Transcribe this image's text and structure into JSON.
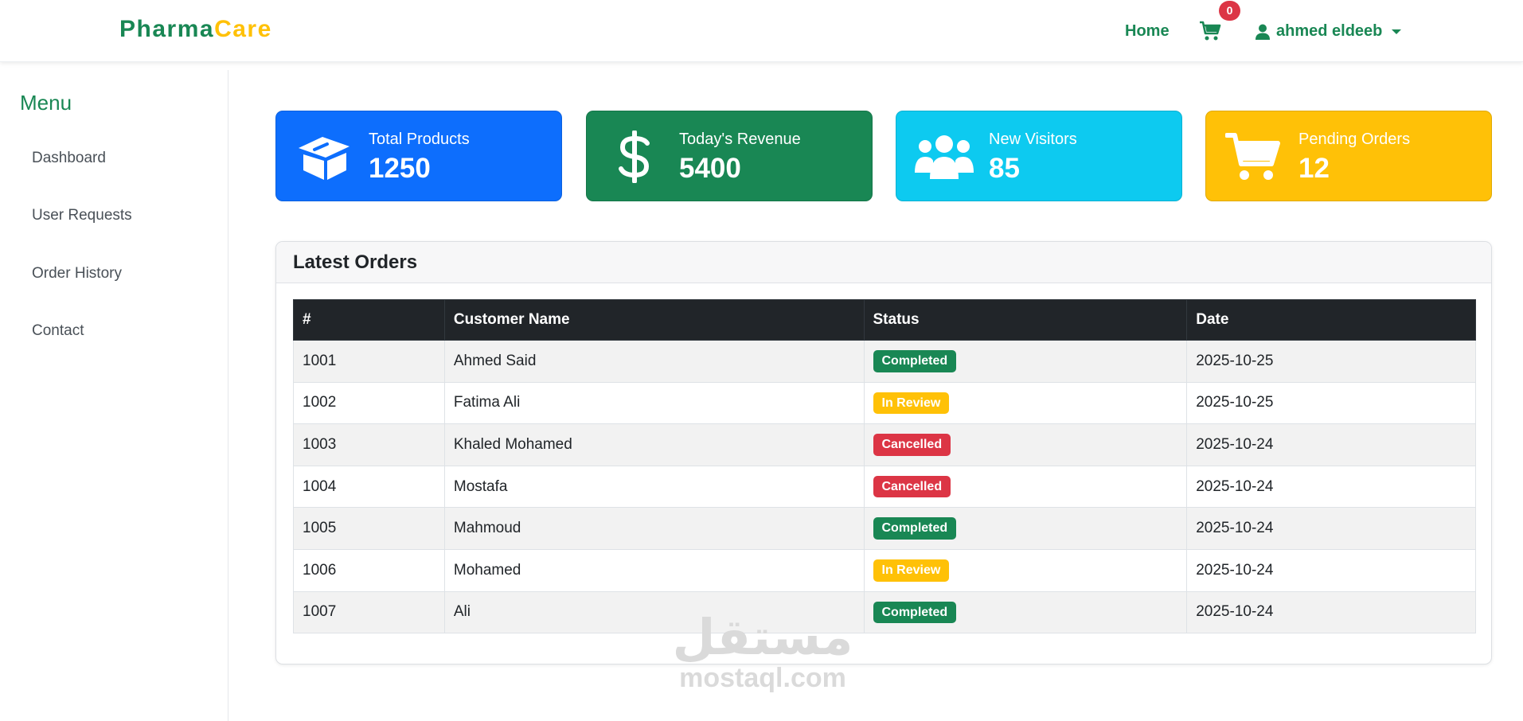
{
  "brand": {
    "part1": "Pharma",
    "part2": "Care"
  },
  "nav": {
    "home": "Home",
    "cart_count": "0",
    "user": "ahmed eldeeb"
  },
  "sidebar": {
    "title": "Menu",
    "items": [
      {
        "label": "Dashboard"
      },
      {
        "label": "User Requests"
      },
      {
        "label": "Order History"
      },
      {
        "label": "Contact"
      }
    ]
  },
  "stats": [
    {
      "label": "Total Products",
      "value": "1250",
      "icon": "box-icon",
      "color": "#0d6efd"
    },
    {
      "label": "Today's Revenue",
      "value": "5400",
      "icon": "dollar-icon",
      "color": "#198754"
    },
    {
      "label": "New Visitors",
      "value": "85",
      "icon": "users-icon",
      "color": "#0dcaf0"
    },
    {
      "label": "Pending Orders",
      "value": "12",
      "icon": "cart-icon",
      "color": "#ffc107"
    }
  ],
  "orders": {
    "title": "Latest Orders",
    "columns": [
      "#",
      "Customer Name",
      "Status",
      "Date"
    ],
    "rows": [
      {
        "id": "1001",
        "name": "Ahmed Said",
        "status": "Completed",
        "date": "2025-10-25"
      },
      {
        "id": "1002",
        "name": "Fatima Ali",
        "status": "In Review",
        "date": "2025-10-25"
      },
      {
        "id": "1003",
        "name": "Khaled Mohamed",
        "status": "Cancelled",
        "date": "2025-10-24"
      },
      {
        "id": "1004",
        "name": "Mostafa",
        "status": "Cancelled",
        "date": "2025-10-24"
      },
      {
        "id": "1005",
        "name": "Mahmoud",
        "status": "Completed",
        "date": "2025-10-24"
      },
      {
        "id": "1006",
        "name": "Mohamed",
        "status": "In Review",
        "date": "2025-10-24"
      },
      {
        "id": "1007",
        "name": "Ali",
        "status": "Completed",
        "date": "2025-10-24"
      }
    ]
  },
  "watermark": {
    "arabic": "مستقل",
    "latin": "mostaql.com"
  },
  "colors": {
    "primary": "#198754",
    "accent": "#ffc107",
    "danger": "#dc3545",
    "dark": "#212529"
  }
}
